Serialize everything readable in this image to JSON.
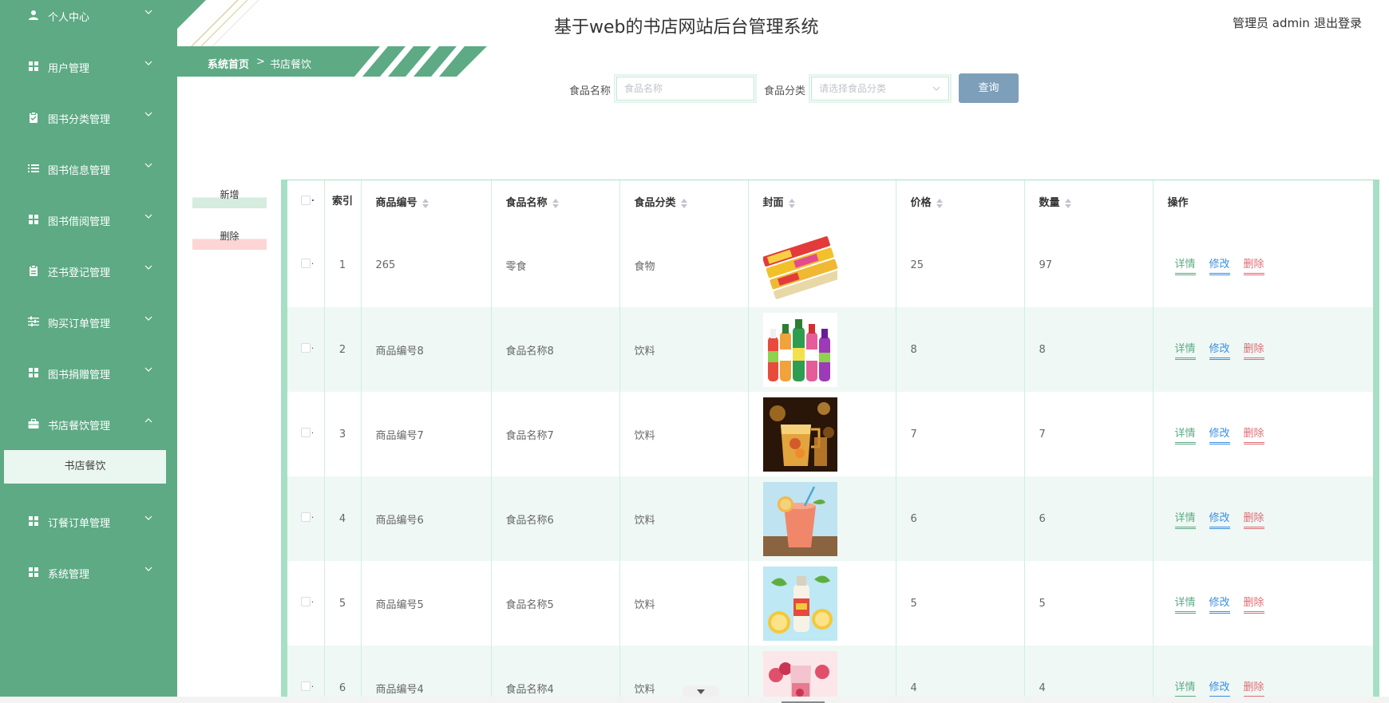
{
  "app": {
    "title": "基于web的书店网站后台管理系统",
    "user_label": "管理员 admin",
    "logout_label": "退出登录"
  },
  "colors": {
    "sidebar_bg": "#5daa84",
    "accent": "#5daa84",
    "query_button": "#7e9fb9",
    "row_alt": "#eff8f4",
    "link_edit": "#3a8ee6",
    "link_delete": "#e06c75"
  },
  "sidebar": {
    "items": [
      {
        "label": "个人中心",
        "icon": "user-icon",
        "expanded": false
      },
      {
        "label": "用户管理",
        "icon": "grid-icon",
        "expanded": false
      },
      {
        "label": "图书分类管理",
        "icon": "clipboard-icon",
        "expanded": false
      },
      {
        "label": "图书信息管理",
        "icon": "list-icon",
        "expanded": false
      },
      {
        "label": "图书借阅管理",
        "icon": "grid-icon",
        "expanded": false
      },
      {
        "label": "还书登记管理",
        "icon": "clipboard-icon",
        "expanded": false
      },
      {
        "label": "购买订单管理",
        "icon": "sliders-icon",
        "expanded": false
      },
      {
        "label": "图书捐赠管理",
        "icon": "grid-icon",
        "expanded": false
      },
      {
        "label": "书店餐饮管理",
        "icon": "briefcase-icon",
        "expanded": true
      },
      {
        "label": "订餐订单管理",
        "icon": "grid-icon",
        "expanded": false
      },
      {
        "label": "系统管理",
        "icon": "grid-icon",
        "expanded": false
      }
    ],
    "active_sub": "书店餐饮"
  },
  "breadcrumb": {
    "home": "系统首页",
    "separator": ">",
    "current": "书店餐饮"
  },
  "search": {
    "name_label": "食品名称",
    "name_placeholder": "食品名称",
    "category_label": "食品分类",
    "category_placeholder": "请选择食品分类",
    "query_label": "查询"
  },
  "actions": {
    "add_label": "新增",
    "delete_label": "删除"
  },
  "table": {
    "columns": {
      "index": "索引",
      "code": "商品编号",
      "name": "食品名称",
      "category": "食品分类",
      "cover": "封面",
      "price": "价格",
      "quantity": "数量",
      "ops": "操作"
    },
    "op_labels": {
      "detail": "详情",
      "edit": "修改",
      "delete": "删除"
    },
    "rows": [
      {
        "index": "1",
        "code": "265",
        "name": "零食",
        "category": "食物",
        "price": "25",
        "quantity": "97",
        "cover": "snack-image"
      },
      {
        "index": "2",
        "code": "商品编号8",
        "name": "食品名称8",
        "category": "饮料",
        "price": "8",
        "quantity": "8",
        "cover": "bottled-drinks-image"
      },
      {
        "index": "3",
        "code": "商品编号7",
        "name": "食品名称7",
        "category": "饮料",
        "price": "7",
        "quantity": "7",
        "cover": "cocktail-image"
      },
      {
        "index": "4",
        "code": "商品编号6",
        "name": "食品名称6",
        "category": "饮料",
        "price": "6",
        "quantity": "6",
        "cover": "grapefruit-juice-image"
      },
      {
        "index": "5",
        "code": "商品编号5",
        "name": "食品名称5",
        "category": "饮料",
        "price": "5",
        "quantity": "5",
        "cover": "lemon-drink-image"
      },
      {
        "index": "6",
        "code": "商品编号4",
        "name": "食品名称4",
        "category": "饮料",
        "price": "4",
        "quantity": "4",
        "cover": "berry-drink-image"
      }
    ]
  }
}
